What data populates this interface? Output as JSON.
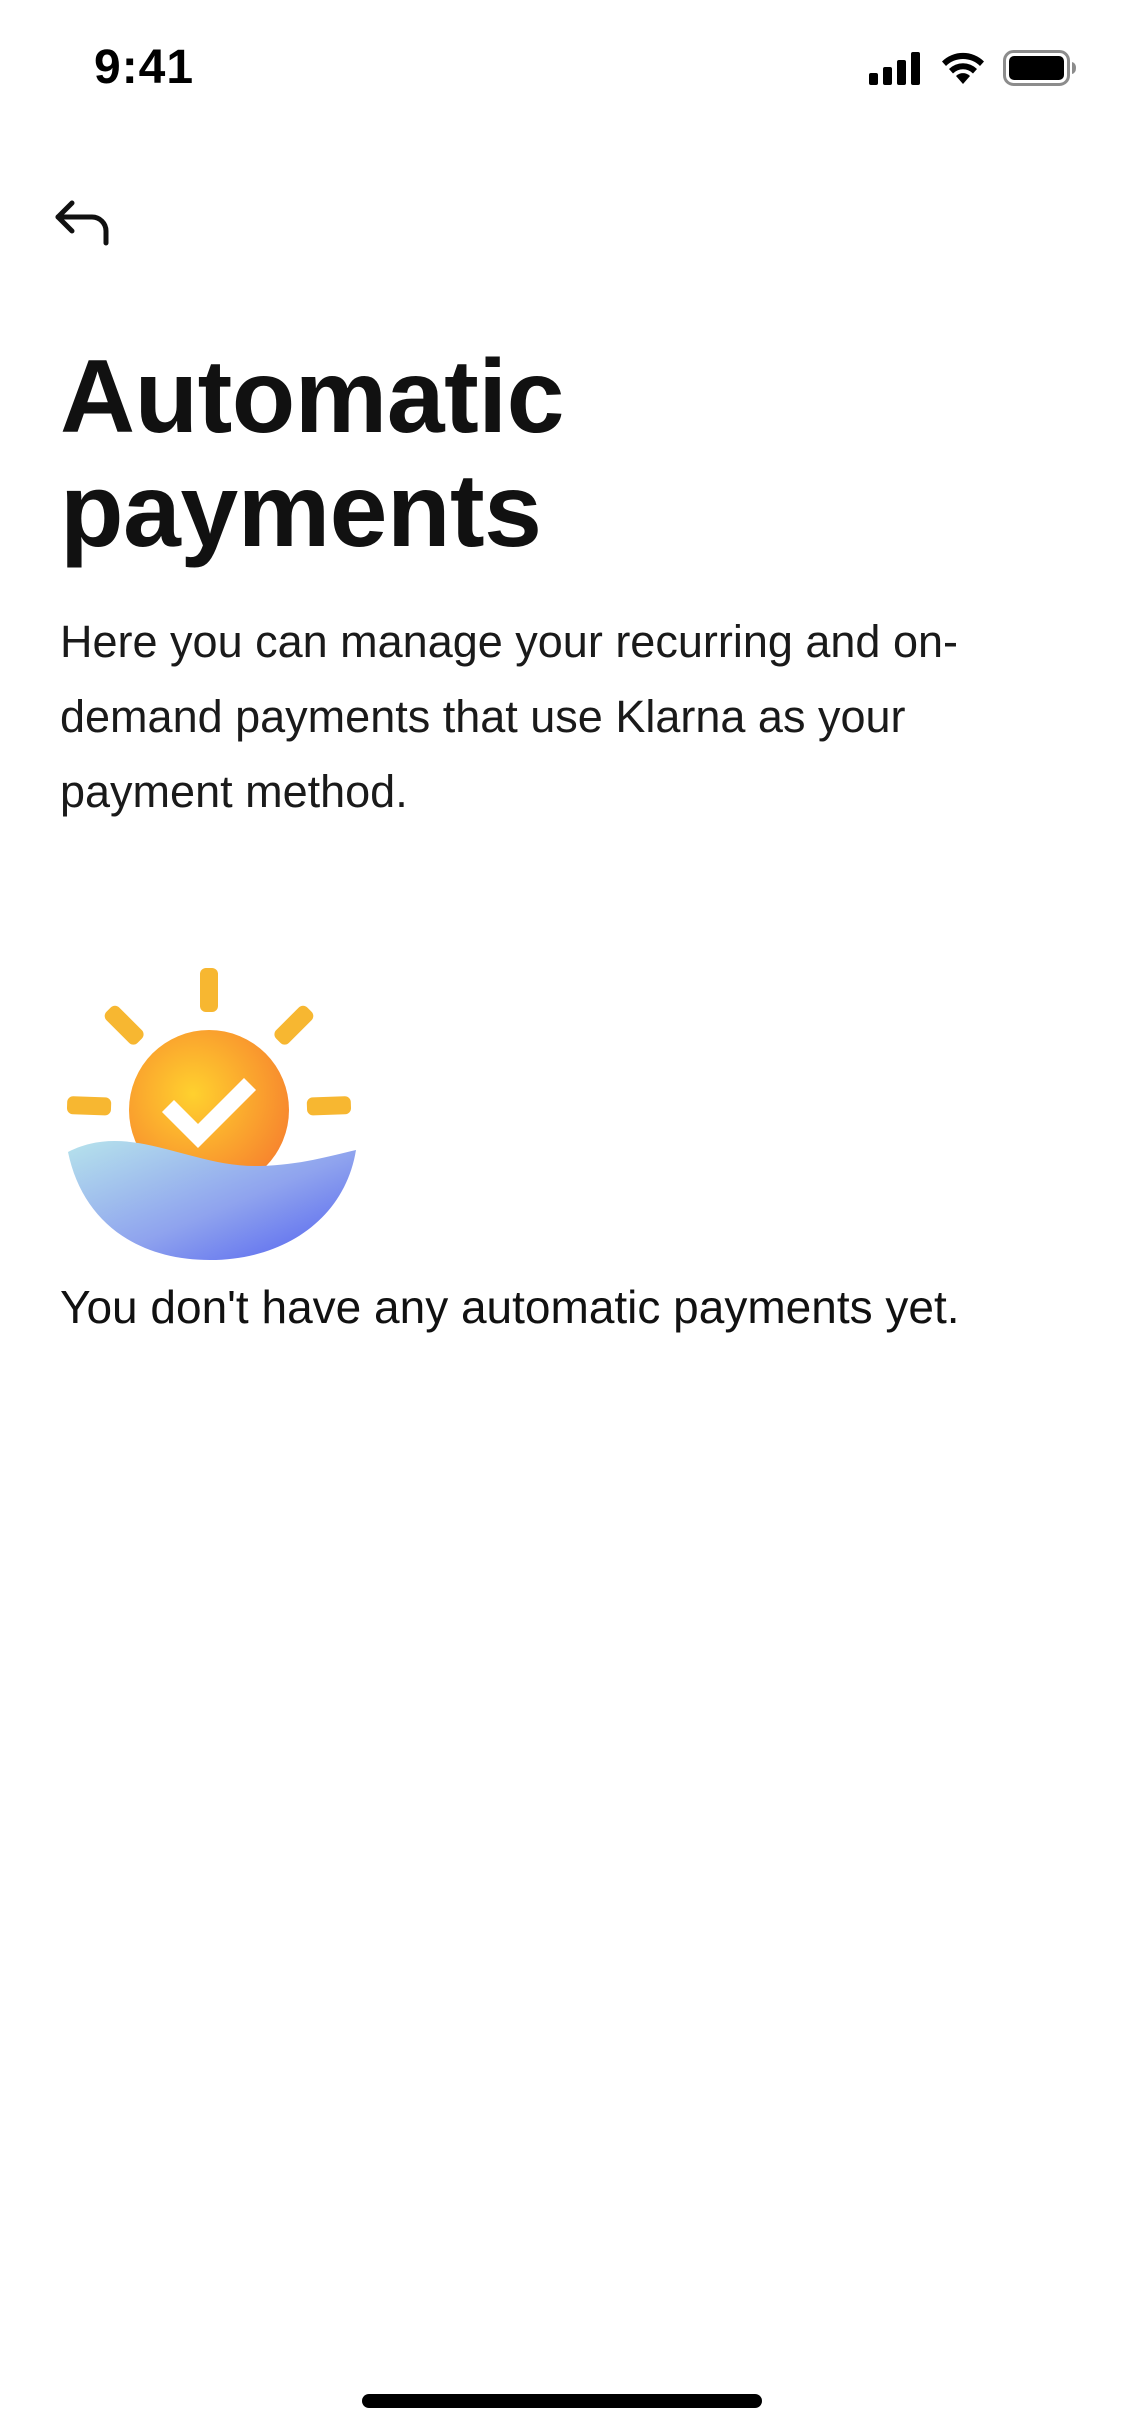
{
  "status_bar": {
    "time": "9:41",
    "signal_icon": "cellular-signal-icon",
    "wifi_icon": "wifi-icon",
    "battery_icon": "battery-icon"
  },
  "header": {
    "back_icon": "back-arrow-icon"
  },
  "main": {
    "title": "Automatic payments",
    "description": "Here you can manage your recurring and on-demand payments that use Klarna as your payment method.",
    "illustration_icon": "sun-check-wave-icon",
    "empty_message": "You don't have any automatic payments yet."
  },
  "colors": {
    "sun_ray": "#F7B731",
    "sun_orange": "#F7912F",
    "wave_light": "#A9DCEB",
    "wave_dark": "#5B6CF0",
    "text": "#111111"
  }
}
